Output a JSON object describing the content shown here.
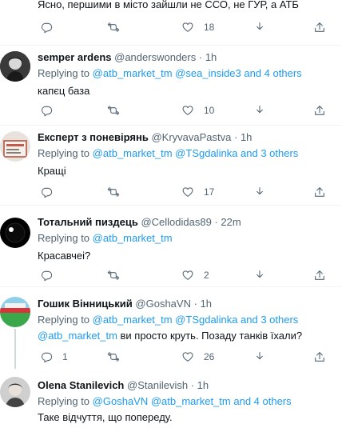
{
  "tweets": [
    {
      "text": "Ясно, першими в місто зайшли не ССО, не ГУР, а АТБ",
      "likes": "18"
    },
    {
      "name": "semper ardens",
      "handle": "@anderswonders",
      "sep": "·",
      "time": "1h",
      "replying_prefix": "Replying to",
      "mentions": "@atb_market_tm @sea_inside3 and 4 others",
      "text": "капєц база",
      "likes": "10"
    },
    {
      "name": "Експерт з поневірянь",
      "handle": "@KryvavaPastva",
      "sep": "·",
      "time": "1h",
      "replying_prefix": "Replying to",
      "mentions": "@atb_market_tm @TSgdalinka and 3 others",
      "text": "Кращі",
      "likes": "17"
    },
    {
      "name": "Тотальний пиздець",
      "handle": "@Cellodidas89",
      "sep": "·",
      "time": "22m",
      "replying_prefix": "Replying to",
      "mentions": "@atb_market_tm",
      "text": "Красавчеі?",
      "likes": "2"
    },
    {
      "name": "Гошик Вінницький",
      "handle": "@GoshaVN",
      "sep": "·",
      "time": "1h",
      "replying_prefix": "Replying to",
      "mentions": "@atb_market_tm @TSgdalinka and 3 others",
      "text_mention": "@atb_market_tm",
      "text": " ви просто круть. Позаду танків їхали?",
      "replies": "1",
      "likes": "26"
    },
    {
      "name": "Olena Stanilevich",
      "handle": "@Stanilevish",
      "sep": "·",
      "time": "1h",
      "replying_prefix": "Replying to",
      "mentions": "@GoshaVN @atb_market_tm and 4 others",
      "text": "Таке відчуття, що попереду."
    }
  ],
  "colors": {
    "accent": "#1d9bf0",
    "muted": "#536471",
    "text": "#0f1419",
    "divider": "#eff3f4"
  },
  "icons": [
    "reply-icon",
    "retweet-icon",
    "like-icon",
    "download-icon",
    "share-icon",
    "more-icon"
  ]
}
